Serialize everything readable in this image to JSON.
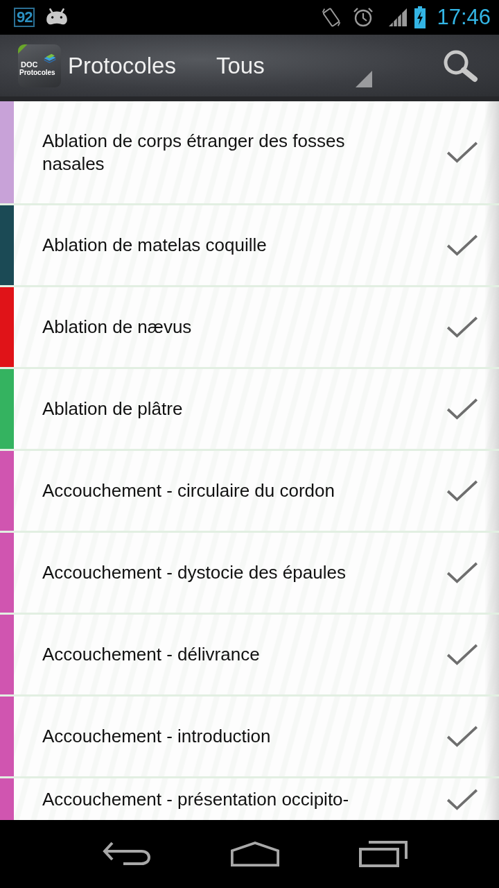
{
  "status_bar": {
    "notification_count": "92",
    "time": "17:46"
  },
  "action_bar": {
    "logo": {
      "line_1": "DOC",
      "line_2": "Protocoles"
    },
    "title": "Protocoles",
    "filter": {
      "value": "Tous"
    }
  },
  "protocols": [
    {
      "title": "Ablation de corps étranger des fosses nasales",
      "color": "#c8a2d8",
      "checked": true
    },
    {
      "title": "Ablation de matelas coquille",
      "color": "#1b4a55",
      "checked": true
    },
    {
      "title": "Ablation de nævus",
      "color": "#e01318",
      "checked": true
    },
    {
      "title": "Ablation de plâtre",
      "color": "#34b360",
      "checked": true
    },
    {
      "title": "Accouchement - circulaire du cordon",
      "color": "#d055b0",
      "checked": true
    },
    {
      "title": "Accouchement - dystocie des épaules",
      "color": "#d055b0",
      "checked": true
    },
    {
      "title": "Accouchement - délivrance",
      "color": "#d055b0",
      "checked": true
    },
    {
      "title": "Accouchement - introduction",
      "color": "#d055b0",
      "checked": true
    },
    {
      "title": "Accouchement - présentation occipito-",
      "color": "#d055b0",
      "checked": true
    }
  ]
}
